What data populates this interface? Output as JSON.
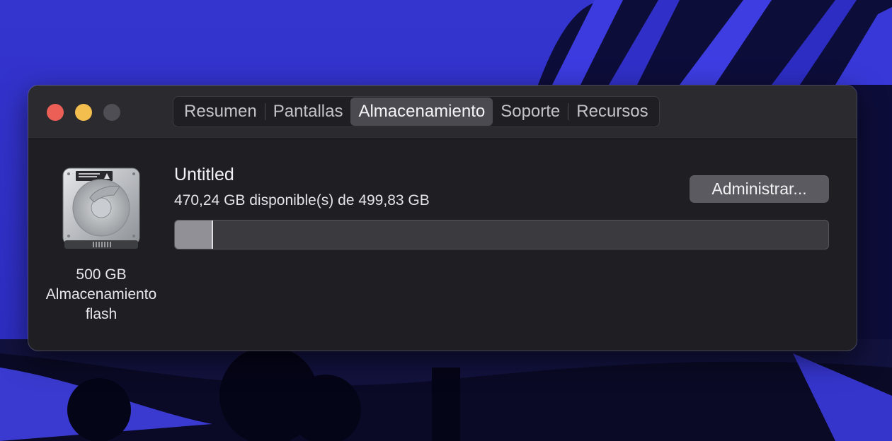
{
  "window": {
    "traffic_lights": [
      "close",
      "minimize",
      "zoom"
    ]
  },
  "tabs": [
    {
      "label": "Resumen",
      "active": false
    },
    {
      "label": "Pantallas",
      "active": false
    },
    {
      "label": "Almacenamiento",
      "active": true
    },
    {
      "label": "Soporte",
      "active": false
    },
    {
      "label": "Recursos",
      "active": false
    }
  ],
  "disk": {
    "icon": "hard-drive-icon",
    "caption_line1": "500 GB",
    "caption_line2": "Almacenamiento",
    "caption_line3": "flash"
  },
  "volume": {
    "name": "Untitled",
    "info": "470,24 GB disponible(s) de 499,83 GB",
    "used_fraction": 0.059,
    "manage_label": "Administrar..."
  },
  "colors": {
    "close": "#ec5f57",
    "minimize": "#f4be4f",
    "zoom_inactive": "#4e4e54",
    "window_bg": "#1e1e23"
  }
}
